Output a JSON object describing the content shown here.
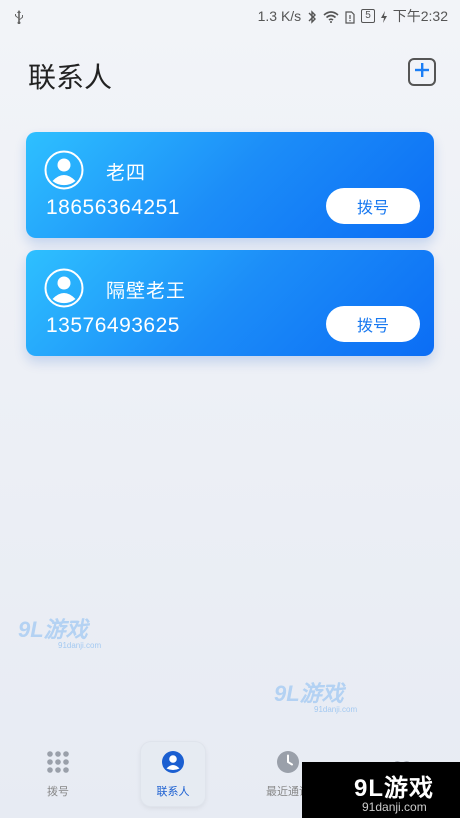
{
  "status_bar": {
    "speed": "1.3 K/s",
    "battery": "5",
    "time": "下午2:32"
  },
  "header": {
    "title": "联系人"
  },
  "contacts": [
    {
      "name": "老四",
      "phone": "18656364251",
      "action": "拨号"
    },
    {
      "name": "隔壁老王",
      "phone": "13576493625",
      "action": "拨号"
    }
  ],
  "watermarks": [
    {
      "logo": "9L游戏",
      "url": "91danji.com"
    },
    {
      "logo": "9L游戏",
      "url": "91danji.com"
    }
  ],
  "tabs": [
    {
      "label": "拨号",
      "icon": "dialpad-icon"
    },
    {
      "label": "联系人",
      "icon": "contacts-icon",
      "active": true
    },
    {
      "label": "最近通话",
      "icon": "clock-icon"
    },
    {
      "label": "",
      "icon": "heart-icon"
    }
  ],
  "brand": {
    "logo": "9L游戏",
    "url": "91danji.com"
  },
  "colors": {
    "card_start": "#2ec0ff",
    "card_end": "#0b6df5",
    "accent": "#1979f0",
    "active_tab": "#1b5fd1"
  }
}
